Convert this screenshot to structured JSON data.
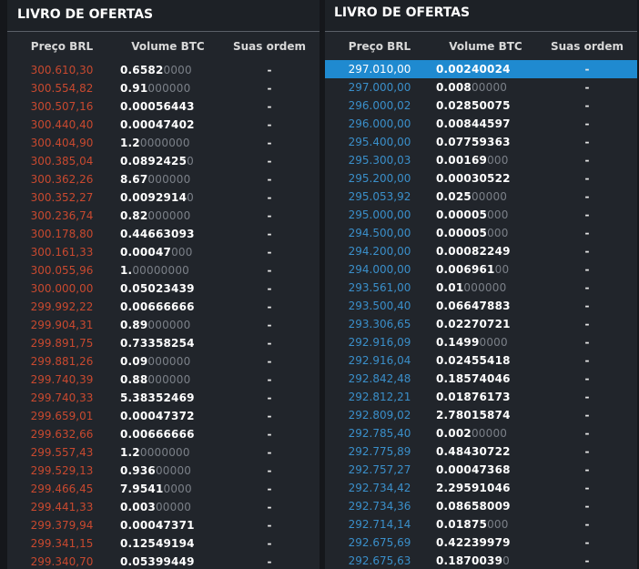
{
  "sell_book": {
    "title": "LIVRO DE OFERTAS",
    "columns": [
      "Preço BRL",
      "Volume BTC",
      "Suas ordem"
    ],
    "rows": [
      {
        "price": "300.610,30",
        "vol_b": "0.6582",
        "vol_z": "0000",
        "mine": "-"
      },
      {
        "price": "300.554,82",
        "vol_b": "0.91",
        "vol_z": "000000",
        "mine": "-"
      },
      {
        "price": "300.507,16",
        "vol_b": "0.00056443",
        "vol_z": "",
        "mine": "-"
      },
      {
        "price": "300.440,40",
        "vol_b": "0.00047402",
        "vol_z": "",
        "mine": "-"
      },
      {
        "price": "300.404,90",
        "vol_b": "1.2",
        "vol_z": "0000000",
        "mine": "-"
      },
      {
        "price": "300.385,04",
        "vol_b": "0.0892425",
        "vol_z": "0",
        "mine": "-"
      },
      {
        "price": "300.362,26",
        "vol_b": "8.67",
        "vol_z": "000000",
        "mine": "-"
      },
      {
        "price": "300.352,27",
        "vol_b": "0.0092914",
        "vol_z": "0",
        "mine": "-"
      },
      {
        "price": "300.236,74",
        "vol_b": "0.82",
        "vol_z": "000000",
        "mine": "-"
      },
      {
        "price": "300.178,80",
        "vol_b": "0.44663093",
        "vol_z": "",
        "mine": "-"
      },
      {
        "price": "300.161,33",
        "vol_b": "0.00047",
        "vol_z": "000",
        "mine": "-"
      },
      {
        "price": "300.055,96",
        "vol_b": "1.",
        "vol_z": "00000000",
        "mine": "-"
      },
      {
        "price": "300.000,00",
        "vol_b": "0.05023439",
        "vol_z": "",
        "mine": "-"
      },
      {
        "price": "299.992,22",
        "vol_b": "0.00666666",
        "vol_z": "",
        "mine": "-"
      },
      {
        "price": "299.904,31",
        "vol_b": "0.89",
        "vol_z": "000000",
        "mine": "-"
      },
      {
        "price": "299.891,75",
        "vol_b": "0.73358254",
        "vol_z": "",
        "mine": "-"
      },
      {
        "price": "299.881,26",
        "vol_b": "0.09",
        "vol_z": "000000",
        "mine": "-"
      },
      {
        "price": "299.740,39",
        "vol_b": "0.88",
        "vol_z": "000000",
        "mine": "-"
      },
      {
        "price": "299.740,33",
        "vol_b": "5.38352469",
        "vol_z": "",
        "mine": "-"
      },
      {
        "price": "299.659,01",
        "vol_b": "0.00047372",
        "vol_z": "",
        "mine": "-"
      },
      {
        "price": "299.632,66",
        "vol_b": "0.00666666",
        "vol_z": "",
        "mine": "-"
      },
      {
        "price": "299.557,43",
        "vol_b": "1.2",
        "vol_z": "0000000",
        "mine": "-"
      },
      {
        "price": "299.529,13",
        "vol_b": "0.936",
        "vol_z": "00000",
        "mine": "-"
      },
      {
        "price": "299.466,45",
        "vol_b": "7.9541",
        "vol_z": "0000",
        "mine": "-"
      },
      {
        "price": "299.441,33",
        "vol_b": "0.003",
        "vol_z": "00000",
        "mine": "-"
      },
      {
        "price": "299.379,94",
        "vol_b": "0.00047371",
        "vol_z": "",
        "mine": "-"
      },
      {
        "price": "299.341,15",
        "vol_b": "0.12549194",
        "vol_z": "",
        "mine": "-"
      },
      {
        "price": "299.340,70",
        "vol_b": "0.05399449",
        "vol_z": "",
        "mine": "-"
      }
    ]
  },
  "buy_book": {
    "title": "LIVRO DE OFERTAS",
    "columns": [
      "Preço BRL",
      "Volume BTC",
      "Suas ordem"
    ],
    "rows": [
      {
        "price": "297.010,00",
        "vol_b": "0.00240024",
        "vol_z": "",
        "mine": "-",
        "selected": true
      },
      {
        "price": "297.000,00",
        "vol_b": "0.008",
        "vol_z": "00000",
        "mine": "-"
      },
      {
        "price": "296.000,02",
        "vol_b": "0.02850075",
        "vol_z": "",
        "mine": "-"
      },
      {
        "price": "296.000,00",
        "vol_b": "0.00844597",
        "vol_z": "",
        "mine": "-"
      },
      {
        "price": "295.400,00",
        "vol_b": "0.07759363",
        "vol_z": "",
        "mine": "-"
      },
      {
        "price": "295.300,03",
        "vol_b": "0.00169",
        "vol_z": "000",
        "mine": "-"
      },
      {
        "price": "295.200,00",
        "vol_b": "0.00030522",
        "vol_z": "",
        "mine": "-"
      },
      {
        "price": "295.053,92",
        "vol_b": "0.025",
        "vol_z": "00000",
        "mine": "-"
      },
      {
        "price": "295.000,00",
        "vol_b": "0.00005",
        "vol_z": "000",
        "mine": "-"
      },
      {
        "price": "294.500,00",
        "vol_b": "0.00005",
        "vol_z": "000",
        "mine": "-"
      },
      {
        "price": "294.200,00",
        "vol_b": "0.00082249",
        "vol_z": "",
        "mine": "-"
      },
      {
        "price": "294.000,00",
        "vol_b": "0.006961",
        "vol_z": "00",
        "mine": "-"
      },
      {
        "price": "293.561,00",
        "vol_b": "0.01",
        "vol_z": "000000",
        "mine": "-"
      },
      {
        "price": "293.500,40",
        "vol_b": "0.06647883",
        "vol_z": "",
        "mine": "-"
      },
      {
        "price": "293.306,65",
        "vol_b": "0.02270721",
        "vol_z": "",
        "mine": "-"
      },
      {
        "price": "292.916,09",
        "vol_b": "0.1499",
        "vol_z": "0000",
        "mine": "-"
      },
      {
        "price": "292.916,04",
        "vol_b": "0.02455418",
        "vol_z": "",
        "mine": "-"
      },
      {
        "price": "292.842,48",
        "vol_b": "0.18574046",
        "vol_z": "",
        "mine": "-"
      },
      {
        "price": "292.812,21",
        "vol_b": "0.01876173",
        "vol_z": "",
        "mine": "-"
      },
      {
        "price": "292.809,02",
        "vol_b": "2.78015874",
        "vol_z": "",
        "mine": "-"
      },
      {
        "price": "292.785,40",
        "vol_b": "0.002",
        "vol_z": "00000",
        "mine": "-"
      },
      {
        "price": "292.775,89",
        "vol_b": "0.48430722",
        "vol_z": "",
        "mine": "-"
      },
      {
        "price": "292.757,27",
        "vol_b": "0.00047368",
        "vol_z": "",
        "mine": "-"
      },
      {
        "price": "292.734,42",
        "vol_b": "2.29591046",
        "vol_z": "",
        "mine": "-"
      },
      {
        "price": "292.734,36",
        "vol_b": "0.08658009",
        "vol_z": "",
        "mine": "-"
      },
      {
        "price": "292.714,14",
        "vol_b": "0.01875",
        "vol_z": "000",
        "mine": "-"
      },
      {
        "price": "292.675,69",
        "vol_b": "0.42239979",
        "vol_z": "",
        "mine": "-"
      },
      {
        "price": "292.675,63",
        "vol_b": "0.1870039",
        "vol_z": "0",
        "mine": "-"
      }
    ]
  },
  "colors": {
    "sell_price": "#c8492f",
    "buy_price": "#3a8fca",
    "selected_row": "#1f8ad0",
    "background": "#21252b"
  }
}
